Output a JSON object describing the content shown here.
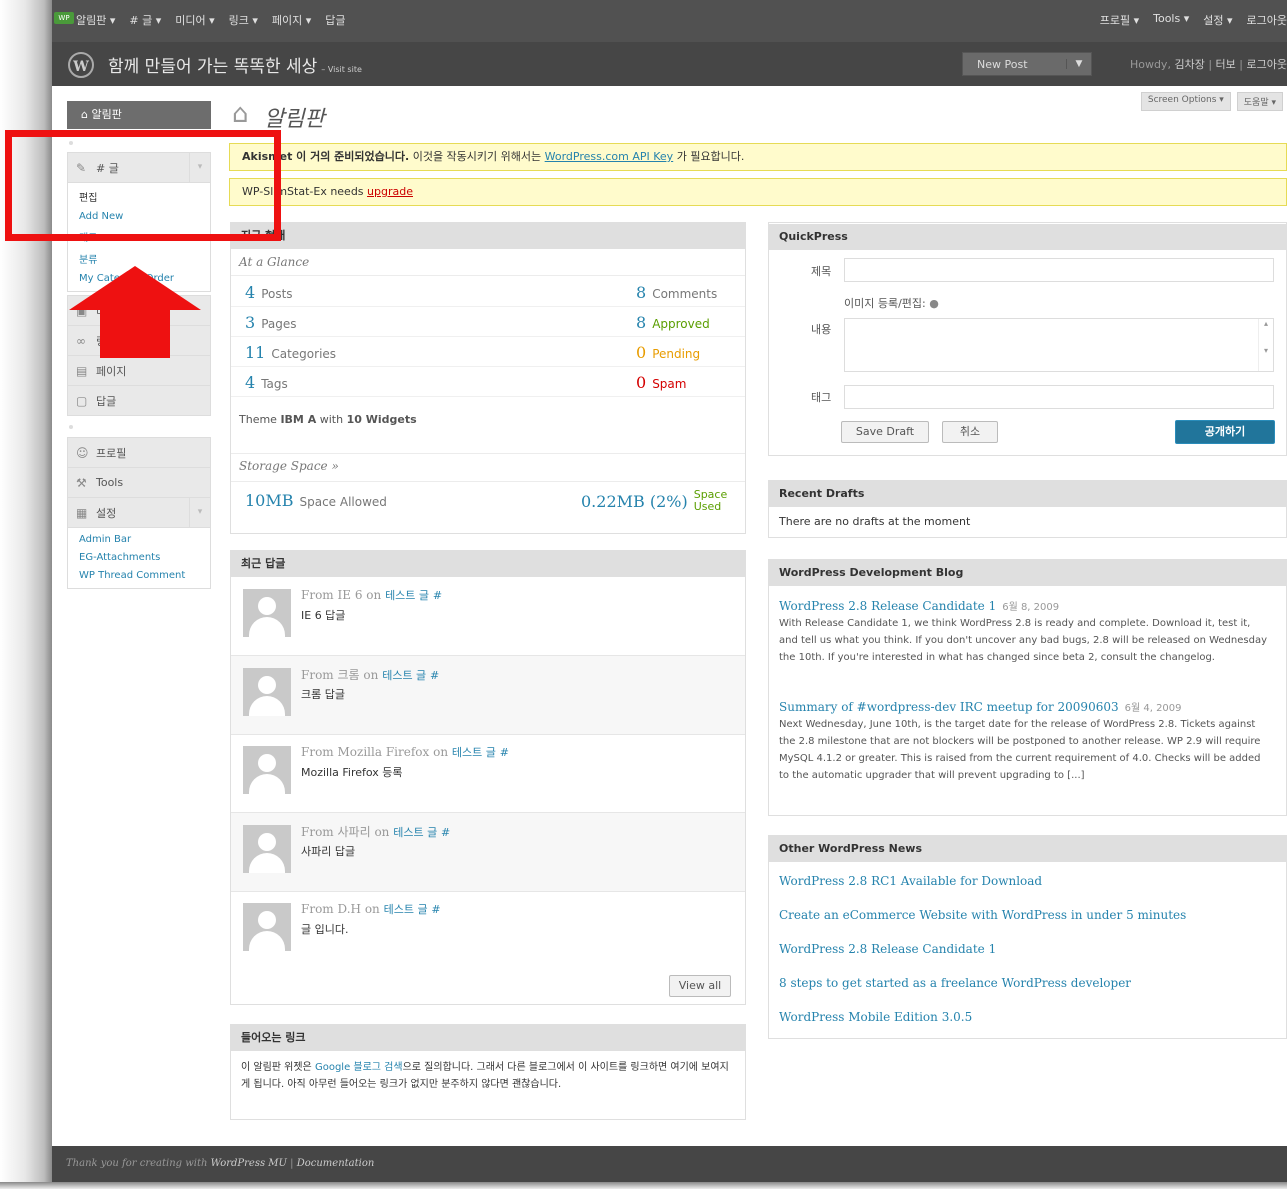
{
  "adminbar": {
    "logo": "WP",
    "menu": [
      "알림판 ▾",
      "# 글 ▾",
      "미디어 ▾",
      "링크 ▾",
      "페이지 ▾",
      "답글"
    ],
    "right": [
      "프로필 ▾",
      "Tools ▾",
      "설정 ▾",
      "로그아웃"
    ]
  },
  "header": {
    "site_title": "함께 만들어 가는 똑똑한 세상",
    "visit_site": "– Visit site",
    "new_post": "New Post",
    "howdy": "Howdy,",
    "user": "김차장",
    "turbo": "터보",
    "logout": "로그아웃",
    "sep": "|"
  },
  "screen_options": [
    "Screen Options ▾",
    "도움말 ▾"
  ],
  "sidebar": {
    "dashboard": "알림판",
    "posts": {
      "label": "# 글",
      "subs": [
        "편집",
        "Add New",
        "태그",
        "분류",
        "My Category Order"
      ]
    },
    "media": "미디어",
    "links": "링크",
    "pages": "페이지",
    "comments": "답글",
    "profile": "프로필",
    "tools": "Tools",
    "settings": {
      "label": "설정",
      "subs": [
        "Admin Bar",
        "EG-Attachments",
        "WP Thread Comment"
      ]
    }
  },
  "page_title": "알림판",
  "notices": {
    "akismet_bold": "Akismet 이 거의 준비되었습니다.",
    "akismet_text": "이것을 작동시키기 위해서는",
    "akismet_link": "WordPress.com API Key",
    "akismet_end": "가 필요합니다.",
    "statex_text": "WP-SlimStat-Ex needs",
    "statex_link": "upgrade"
  },
  "right_now": {
    "title": "지금 현재",
    "subtitle": "At a Glance",
    "left_rows": [
      {
        "num": "4",
        "label": "Posts"
      },
      {
        "num": "3",
        "label": "Pages"
      },
      {
        "num": "11",
        "label": "Categories"
      },
      {
        "num": "4",
        "label": "Tags"
      }
    ],
    "right_rows": [
      {
        "num": "8",
        "label": "Comments"
      },
      {
        "num": "8",
        "label": "Approved"
      },
      {
        "num": "0",
        "label": "Pending"
      },
      {
        "num": "0",
        "label": "Spam"
      }
    ],
    "theme_prefix": "Theme",
    "theme_name": "IBM A",
    "theme_with": "with",
    "widgets": "10 Widgets",
    "storage_title": "Storage Space »",
    "space_allowed_num": "10MB",
    "space_allowed_label": "Space Allowed",
    "space_used_num": "0.22MB (2%)",
    "space_used_label1": "Space",
    "space_used_label2": "Used"
  },
  "recent_comments": {
    "title": "최근 답글",
    "from": "From",
    "on": "on",
    "items": [
      {
        "author": "IE 6",
        "post": "테스트 글",
        "hash": "#",
        "body": "IE 6 답글"
      },
      {
        "author": "크롬",
        "post": "테스트 글",
        "hash": "#",
        "body": "크롬 답글"
      },
      {
        "author": "Mozilla Firefox",
        "post": "테스트 글",
        "hash": "#",
        "body": "Mozilla Firefox 등록"
      },
      {
        "author": "사파리",
        "post": "테스트 글",
        "hash": "#",
        "body": "사파리 답글"
      },
      {
        "author": "D.H",
        "post": "테스트 글",
        "hash": "#",
        "body": "글 입니다."
      }
    ],
    "view_all": "View all"
  },
  "incoming_links": {
    "title": "들어오는 링크",
    "text1": "이 알림판 위젯은",
    "google": "Google",
    "blogsearch": "블로그 검색",
    "text2": "으로 질의합니다. 그래서 다른 블로그에서 이 사이트를 링크하면 여기에 보여지게 됩니다. 아직 아무런 들어오는 링크가 없지만 분주하지 않다면 괜찮습니다."
  },
  "quickpress": {
    "title": "QuickPress",
    "title_label": "제목",
    "media_label": "이미지 등록/편집:",
    "content_label": "내용",
    "tags_label": "태그",
    "save_draft": "Save Draft",
    "cancel": "취소",
    "publish": "공개하기"
  },
  "recent_drafts": {
    "title": "Recent Drafts",
    "empty": "There are no drafts at the moment"
  },
  "dev_blog": {
    "title": "WordPress Development Blog",
    "items": [
      {
        "title": "WordPress 2.8 Release Candidate 1",
        "date": "6월 8, 2009",
        "text": "With Release Candidate 1, we think WordPress 2.8 is ready and complete.  Download it, test it, and tell us what you think.  If you don't uncover any bad bugs, 2.8 will be released on Wednesday the 10th.  If you're interested in what has changed since beta 2, consult the changelog."
      },
      {
        "title": "Summary of #wordpress-dev IRC meetup for 20090603",
        "date": "6월 4, 2009",
        "text": "Next Wednesday, June 10th, is the target date for the release of WordPress 2.8.  Tickets against the 2.8 milestone that are not blockers will be postponed to another release.  WP 2.9 will require MySQL 4.1.2 or greater.  This is raised from the current requirement of 4.0.  Checks will be added to the automatic upgrader that will prevent upgrading to [...]"
      }
    ]
  },
  "other_news": {
    "title": "Other WordPress News",
    "items": [
      "WordPress 2.8 RC1 Available for Download",
      "Create an eCommerce Website with WordPress in under 5 minutes",
      "WordPress 2.8 Release Candidate 1",
      "8 steps to get started as a freelance WordPress developer",
      "WordPress Mobile Edition 3.0.5"
    ]
  },
  "footer": {
    "thanks": "Thank you for creating with",
    "wpmu": "WordPress MU",
    "sep": "|",
    "docs": "Documentation"
  },
  "colors": {
    "link": "#2583ad",
    "highlight": "#ee1111",
    "header": "#464646",
    "approved": "#5a9e00",
    "pending": "#e89c00",
    "spam": "#d40000"
  }
}
